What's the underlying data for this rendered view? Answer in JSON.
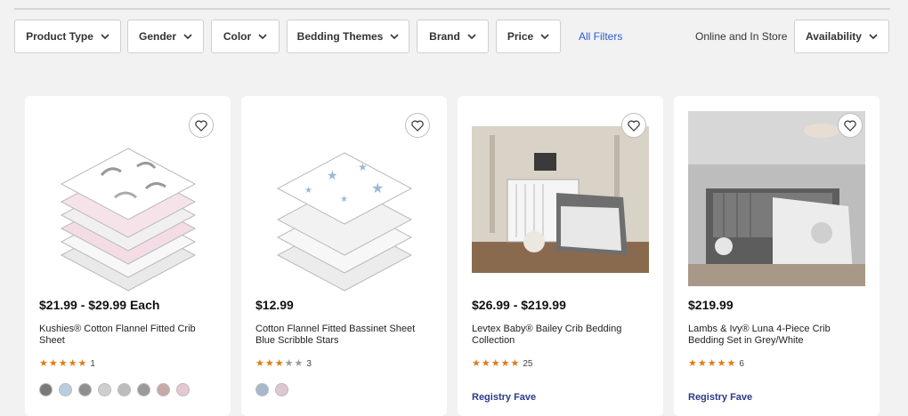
{
  "filters": {
    "product_type": "Product Type",
    "gender": "Gender",
    "color": "Color",
    "bedding_themes": "Bedding Themes",
    "brand": "Brand",
    "price": "Price",
    "all_filters": "All Filters",
    "store_label": "Online and In Store",
    "availability": "Availability"
  },
  "products": [
    {
      "price": "$21.99 - $29.99 Each",
      "title": "Kushies® Cotton Flannel Fitted Crib Sheet",
      "rating": 5,
      "review_count": "1",
      "swatches": [
        "#7a7a7a",
        "#b8cde0",
        "#8f8f8f",
        "#cfcfcf",
        "#bdbdbd",
        "#9a9a9a",
        "#c7a9a8",
        "#e6c8d0"
      ]
    },
    {
      "price": "$12.99",
      "title": "Cotton Flannel Fitted Bassinet Sheet Blue Scribble Stars",
      "rating": 2.5,
      "review_count": "3",
      "swatches": [
        "#a8b8cc",
        "#dec7d3"
      ]
    },
    {
      "price": "$26.99 - $219.99",
      "title": "Levtex Baby® Bailey Crib Bedding Collection",
      "rating": 4.5,
      "review_count": "25",
      "registry": "Registry Fave"
    },
    {
      "price": "$219.99",
      "title": "Lambs & Ivy® Luna 4-Piece Crib Bedding Set in Grey/White",
      "rating": 5,
      "review_count": "6",
      "registry": "Registry Fave"
    }
  ]
}
